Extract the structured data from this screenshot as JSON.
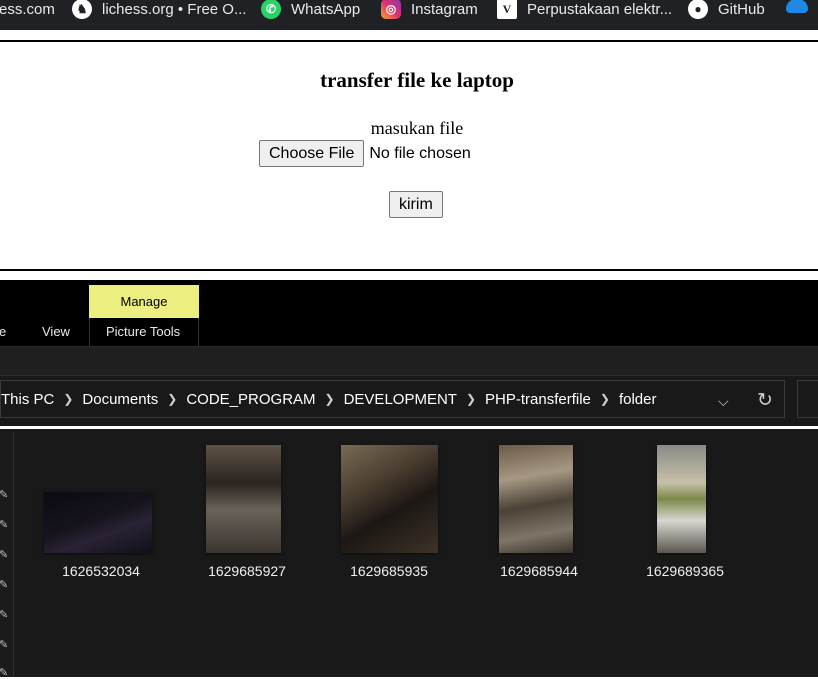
{
  "bookmarks": [
    {
      "label": "ess.com",
      "icon": "chess-com-icon"
    },
    {
      "label": "lichess.org • Free O...",
      "icon": "lichess-icon"
    },
    {
      "label": "WhatsApp",
      "icon": "whatsapp-icon"
    },
    {
      "label": "Instagram",
      "icon": "instagram-icon"
    },
    {
      "label": "Perpustakaan elektr...",
      "icon": "perpustakaan-icon"
    },
    {
      "label": "GitHub",
      "icon": "github-icon"
    }
  ],
  "page": {
    "title": "transfer file ke laptop",
    "file_label": "masukan file",
    "choose_file_label": "Choose File",
    "no_file_text": "No file chosen",
    "submit_label": "kirim"
  },
  "explorer": {
    "ribbon": {
      "manage_label": "Manage",
      "tab_partial": "e",
      "tab_view": "View",
      "tab_picture_tools": "Picture Tools",
      "manage_color": "#ecee7f"
    },
    "address": {
      "crumbs": [
        "This PC",
        "Documents",
        "CODE_PROGRAM",
        "DEVELOPMENT",
        "PHP-transferfile",
        "folder"
      ]
    },
    "files": [
      {
        "name": "1626532034"
      },
      {
        "name": "1629685927"
      },
      {
        "name": "1629685935"
      },
      {
        "name": "1629685944"
      },
      {
        "name": "1629689365"
      }
    ]
  }
}
